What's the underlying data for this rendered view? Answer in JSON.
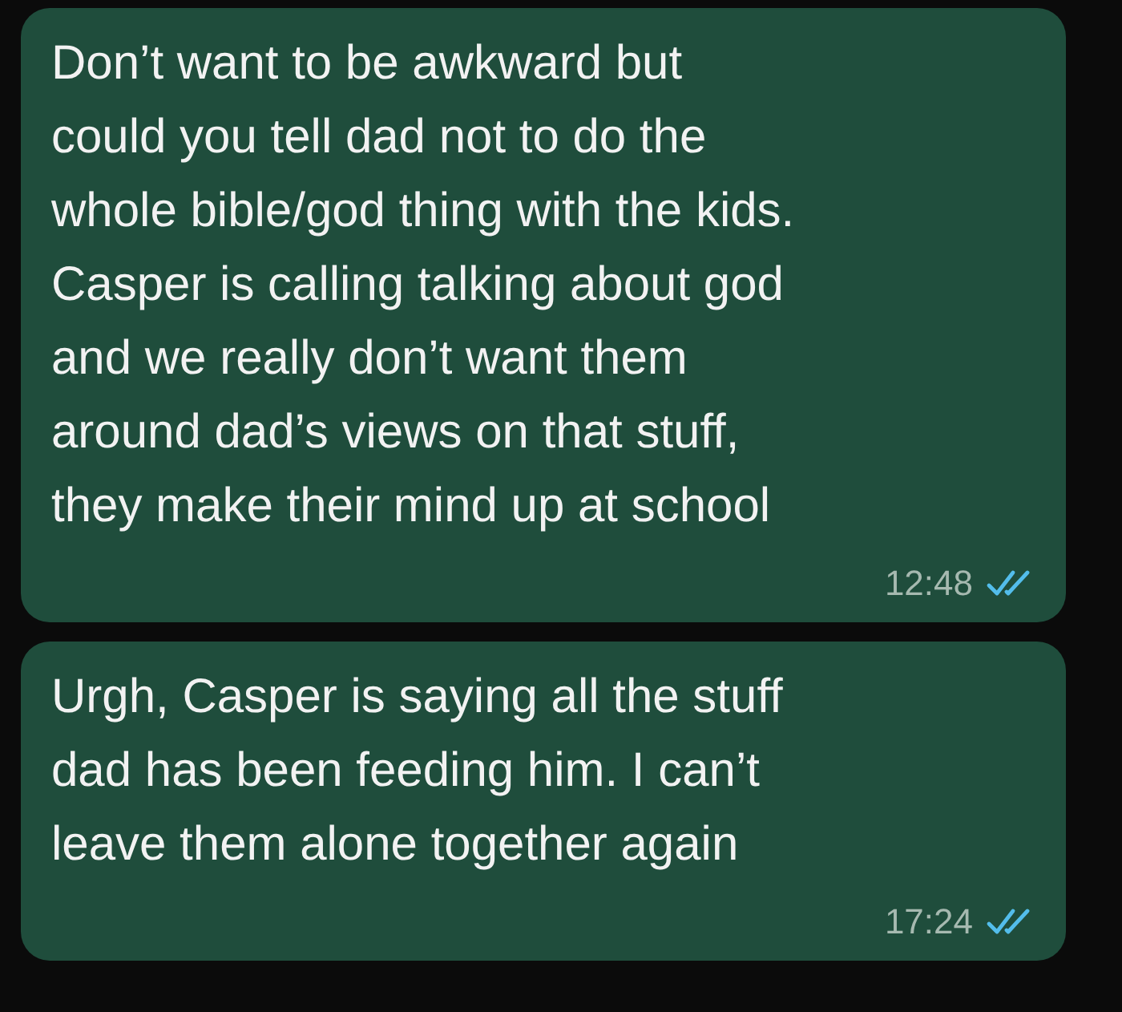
{
  "messages": [
    {
      "lines": [
        "Don’t want to be awkward but",
        "could you tell dad not to do the",
        "whole bible/god thing with the kids.",
        "Casper is calling talking about god",
        "and we really don’t want them",
        "around dad’s views on that stuff,",
        "they make their mind up at school"
      ],
      "time": "12:48",
      "read": true
    },
    {
      "lines": [
        "Urgh, Casper is saying all the stuff",
        "dad has been feeding him. I can’t",
        "leave them alone together again"
      ],
      "time": "17:24",
      "read": true
    }
  ]
}
